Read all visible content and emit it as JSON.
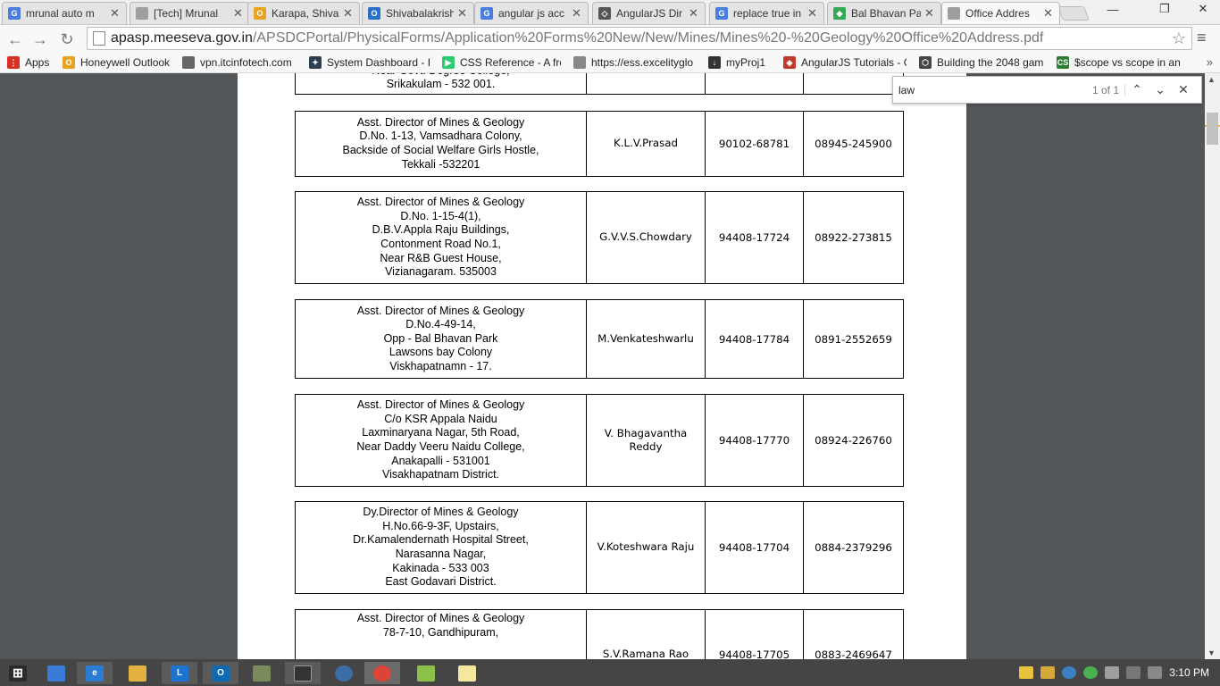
{
  "browser": {
    "tabs": [
      {
        "title": "mrunal auto m",
        "icon_color": "#4a7de0",
        "icon_text": "G"
      },
      {
        "title": "[Tech] Mrunal",
        "icon_color": "#9e9e9e",
        "icon_text": ""
      },
      {
        "title": "Karapa, Shiva",
        "icon_color": "#e8a321",
        "icon_text": "O"
      },
      {
        "title": "Shivabalakrish",
        "icon_color": "#2a6fc9",
        "icon_text": "O"
      },
      {
        "title": "angular js acc",
        "icon_color": "#4a7de0",
        "icon_text": "G"
      },
      {
        "title": "AngularJS Dir",
        "icon_color": "#555555",
        "icon_text": "◇"
      },
      {
        "title": "replace true in",
        "icon_color": "#4a7de0",
        "icon_text": "G"
      },
      {
        "title": "Bal Bhavan Pa",
        "icon_color": "#34a853",
        "icon_text": "◆"
      },
      {
        "title": "Office Addres",
        "icon_color": "#9e9e9e",
        "icon_text": ""
      }
    ],
    "close_glyph": "✕",
    "url_host": "apasp.meeseva.gov.in",
    "url_path": "/APSDCPortal/PhysicalForms/Application%20Forms%20New/New/Mines/Mines%20-%20Geology%20Office%20Address.pdf",
    "bookmarks": [
      {
        "label": "Apps",
        "icon_color": "#d93025",
        "icon_text": "⋮"
      },
      {
        "label": "Honeywell Outlook",
        "icon_color": "#e8a321",
        "icon_text": "O"
      },
      {
        "label": "vpn.itcinfotech.com",
        "icon_color": "#666666",
        "icon_text": ""
      },
      {
        "label": "System Dashboard - I",
        "icon_color": "#2d3e50",
        "icon_text": "✦"
      },
      {
        "label": "CSS Reference - A free",
        "icon_color": "#2ecc71",
        "icon_text": "▶"
      },
      {
        "label": "https://ess.excelityglo",
        "icon_color": "#888888",
        "icon_text": ""
      },
      {
        "label": "myProj1",
        "icon_color": "#333333",
        "icon_text": "↓"
      },
      {
        "label": "AngularJS Tutorials - C",
        "icon_color": "#c0392b",
        "icon_text": "◈"
      },
      {
        "label": "Building the 2048 gam",
        "icon_color": "#444444",
        "icon_text": "⬡"
      },
      {
        "label": "$scope vs scope in an",
        "icon_color": "#2e7d32",
        "icon_text": "CS"
      }
    ],
    "more_glyph": "»"
  },
  "find": {
    "query": "law",
    "count": "1 of 1"
  },
  "pdf": {
    "partial_row": {
      "address": [
        "Near Govt. Degree College,",
        "Srikakulam - 532 001."
      ]
    },
    "rows": [
      {
        "address": [
          "Asst. Director of Mines & Geology",
          "D.No. 1-13, Vamsadhara Colony,",
          "Backside of Social Welfare Girls Hostle,",
          "Tekkali -532201"
        ],
        "officer": "K.L.V.Prasad",
        "mobile": "90102-68781",
        "landline": "08945-245900"
      },
      {
        "address": [
          "Asst. Director of Mines & Geology",
          "D.No. 1-15-4(1),",
          "D.B.V.Appla Raju Buildings,",
          "Contonment Road No.1,",
          "Near R&B Guest House,",
          "Vizianagaram. 535003"
        ],
        "officer": "G.V.V.S.Chowdary",
        "mobile": "94408-17724",
        "landline": "08922-273815"
      },
      {
        "address": [
          "Asst. Director of Mines & Geology",
          "D.No.4-49-14,",
          "Opp - Bal Bhavan Park",
          "Lawsons bay Colony",
          "Viskhapatnamn - 17."
        ],
        "officer": "M.Venkateshwarlu",
        "mobile": "94408-17784",
        "landline": "0891-2552659"
      },
      {
        "address": [
          "Asst. Director of Mines & Geology",
          "C/o KSR Appala Naidu",
          "Laxminaryana Nagar, 5th Road,",
          "Near Daddy Veeru Naidu College,",
          "Anakapalli - 531001",
          "Visakhapatnam District."
        ],
        "officer": "V. Bhagavantha Reddy",
        "mobile": "94408-17770",
        "landline": "08924-226760"
      },
      {
        "address": [
          "Dy.Director of Mines & Geology",
          "H.No.66-9-3F, Upstairs,",
          "Dr.Kamalendernath Hospital Street,",
          "Narasanna Nagar,",
          "Kakinada - 533 003",
          "East Godavari District."
        ],
        "officer": "V.Koteshwara Raju",
        "mobile": "94408-17704",
        "landline": "0884-2379296"
      },
      {
        "address": [
          "Asst. Director of Mines & Geology",
          "78-7-10, Gandhipuram,"
        ],
        "officer": "S.V.Ramana Rao",
        "mobile": "94408-17705",
        "landline": "0883-2469647"
      }
    ]
  },
  "taskbar": {
    "time": "3:10 PM"
  }
}
